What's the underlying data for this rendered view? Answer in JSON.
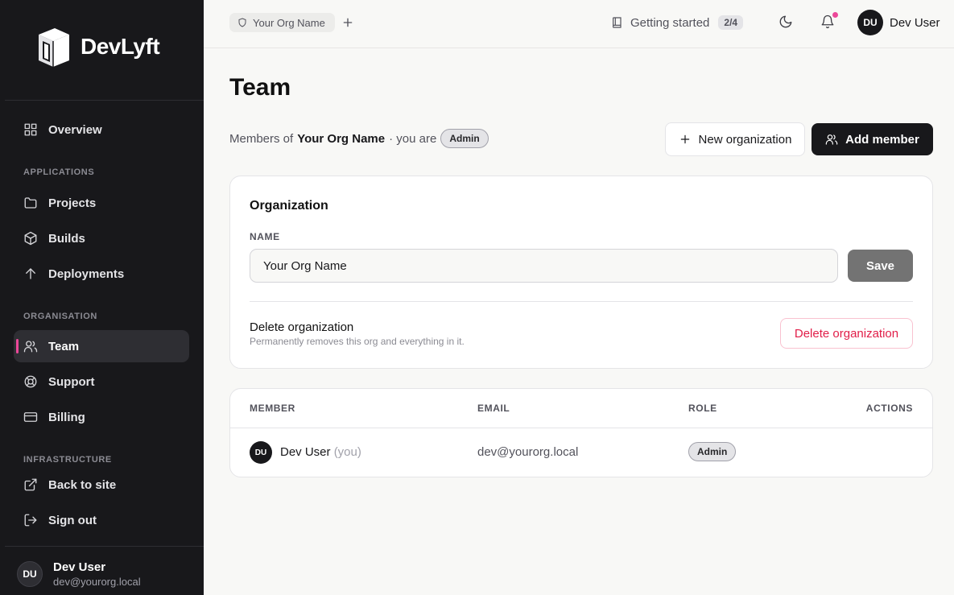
{
  "brand": {
    "name": "DevLyft"
  },
  "sidebar": {
    "overview": "Overview",
    "sections": {
      "applications": "APPLICATIONS",
      "organisation": "ORGANISATION",
      "infrastructure": "INFRASTRUCTURE"
    },
    "items": {
      "projects": "Projects",
      "builds": "Builds",
      "deployments": "Deployments",
      "team": "Team",
      "support": "Support",
      "billing": "Billing",
      "back_to_site": "Back to site",
      "sign_out": "Sign out"
    },
    "active_item": "team",
    "accent_color": "#ec4899",
    "user": {
      "initials": "DU",
      "name": "Dev User",
      "email": "dev@yourorg.local"
    }
  },
  "topbar": {
    "org_name": "Your Org Name",
    "add_icon": "plus-icon",
    "getting_started": {
      "label": "Getting started",
      "progress": "2/4"
    },
    "theme_icon": "moon-icon",
    "notifications_icon": "bell-icon",
    "user": {
      "initials": "DU",
      "name": "Dev User"
    }
  },
  "main": {
    "title": "Team",
    "subline": {
      "prefix": "Members of",
      "org": "Your Org Name",
      "middle": "· you are",
      "role": "Admin"
    },
    "new_org_button": "New organization",
    "add_member_button": "Add member",
    "org_card": {
      "title": "Organization",
      "name_label": "NAME",
      "name_value": "Your Org Name",
      "save_button": "Save",
      "delete_title": "Delete organization",
      "delete_desc": "Permanently removes this org and everything in it.",
      "delete_button": "Delete organization",
      "danger_color": "#e11d48"
    },
    "members_table": {
      "columns": [
        "MEMBER",
        "EMAIL",
        "ROLE",
        "ACTIONS"
      ],
      "rows": [
        {
          "initials": "DU",
          "name": "Dev User",
          "you": "(you)",
          "email": "dev@yourorg.local",
          "role": "Admin"
        }
      ]
    }
  }
}
